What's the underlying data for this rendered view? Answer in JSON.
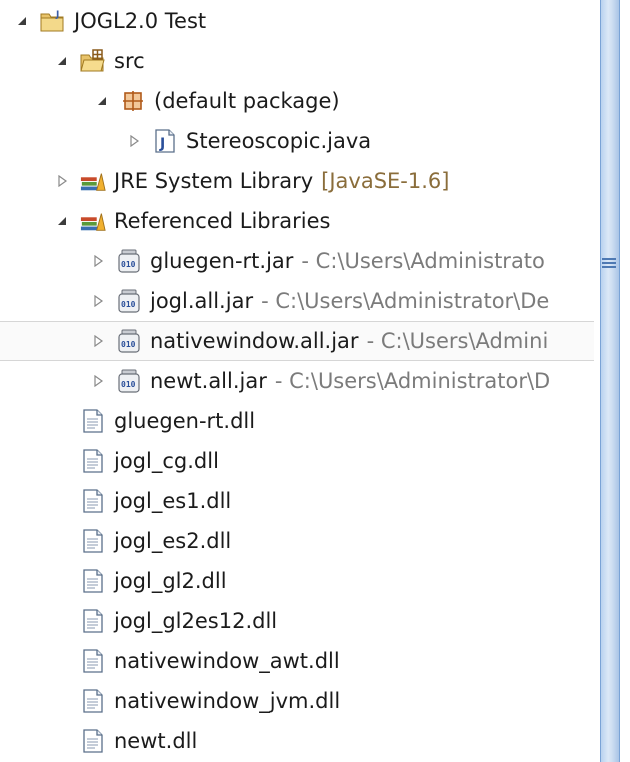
{
  "tree": {
    "project": {
      "label": "JOGL2.0 Test",
      "icon": "java-project-icon",
      "expanded": true
    },
    "src": {
      "label": "src",
      "icon": "source-folder-icon",
      "expanded": true
    },
    "default_package": {
      "label": "(default package)",
      "icon": "package-icon",
      "expanded": true
    },
    "stereoscopic": {
      "label": "Stereoscopic.java",
      "icon": "java-file-icon",
      "expanded": false
    },
    "jre": {
      "label": "JRE System Library",
      "decoration": "[JavaSE-1.6]",
      "icon": "library-icon",
      "expanded": false
    },
    "referenced": {
      "label": "Referenced Libraries",
      "icon": "library-icon",
      "expanded": true
    },
    "jars": [
      {
        "label": "gluegen-rt.jar",
        "path": "- C:\\Users\\Administrato"
      },
      {
        "label": "jogl.all.jar",
        "path": "- C:\\Users\\Administrator\\De"
      },
      {
        "label": "nativewindow.all.jar",
        "path": "- C:\\Users\\Admini"
      },
      {
        "label": "newt.all.jar",
        "path": "- C:\\Users\\Administrator\\D"
      }
    ],
    "files": [
      "gluegen-rt.dll",
      "jogl_cg.dll",
      "jogl_es1.dll",
      "jogl_es2.dll",
      "jogl_gl2.dll",
      "jogl_gl2es12.dll",
      "nativewindow_awt.dll",
      "nativewindow_jvm.dll",
      "newt.dll"
    ]
  },
  "colors": {
    "decoration": "#8a6d3b",
    "path": "#7b7b7b",
    "scrollbar": "#b9d2ef"
  }
}
